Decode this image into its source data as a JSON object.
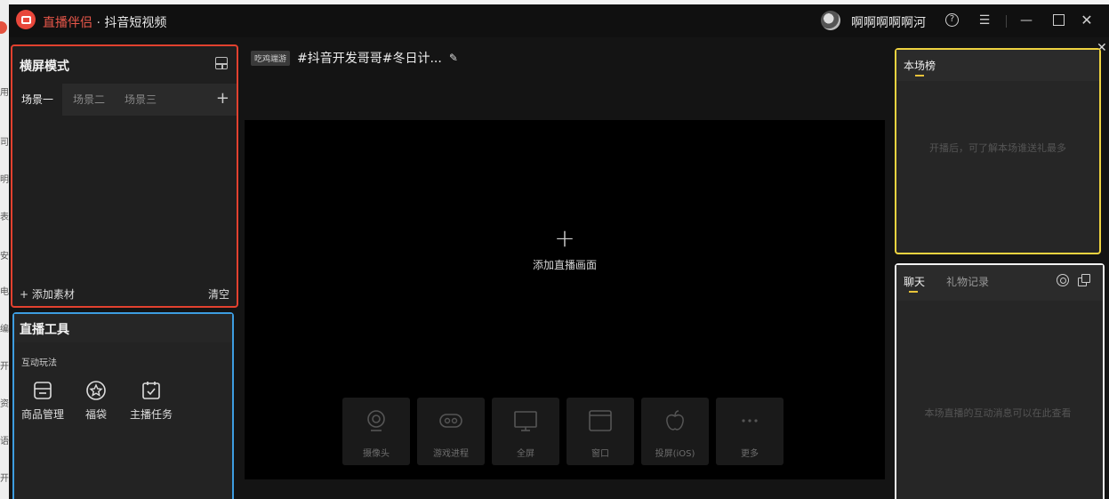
{
  "desktop": {
    "strip_chars": [
      "用",
      "司",
      "明",
      "表",
      "安",
      "电",
      "编",
      "开",
      "资",
      "语",
      "开"
    ]
  },
  "titlebar": {
    "brand": "直播伴侣",
    "separator": " · ",
    "app_name": "抖音短视频",
    "username": "啊啊啊啊啊河"
  },
  "scene_panel": {
    "title": "横屏模式",
    "tabs": [
      {
        "label": "场景一",
        "active": true
      },
      {
        "label": "场景二",
        "active": false
      },
      {
        "label": "场景三",
        "active": false
      }
    ],
    "add_material": "+ 添加素材",
    "clear": "清空"
  },
  "tools_panel": {
    "title": "直播工具",
    "section": "互动玩法",
    "tools": [
      {
        "label": "商品管理",
        "icon": "store-icon"
      },
      {
        "label": "福袋",
        "icon": "star-badge-icon"
      },
      {
        "label": "主播任务",
        "icon": "calendar-check-icon"
      }
    ]
  },
  "stream": {
    "game_tag": "吃鸡端游",
    "title": "#抖音开发哥哥#冬日计..."
  },
  "preview": {
    "add_label": "添加直播画面",
    "sources": [
      {
        "label": "摄像头",
        "icon": "webcam-icon"
      },
      {
        "label": "游戏进程",
        "icon": "gamepad-icon"
      },
      {
        "label": "全屏",
        "icon": "monitor-icon"
      },
      {
        "label": "窗口",
        "icon": "window-icon"
      },
      {
        "label": "投屏(iOS)",
        "icon": "apple-icon"
      },
      {
        "label": "更多",
        "icon": "more-icon"
      }
    ]
  },
  "rank_panel": {
    "title": "本场榜",
    "hint": "开播后，可了解本场谁送礼最多"
  },
  "chat_panel": {
    "tabs": [
      "聊天",
      "礼物记录"
    ],
    "hint": "本场直播的互动消息可以在此查看"
  },
  "colors": {
    "scene_border": "#e2412f",
    "tools_border": "#3d9de0",
    "rank_border": "#efd340",
    "chat_border": "#f2f2f2",
    "brand": "#e9574a"
  }
}
